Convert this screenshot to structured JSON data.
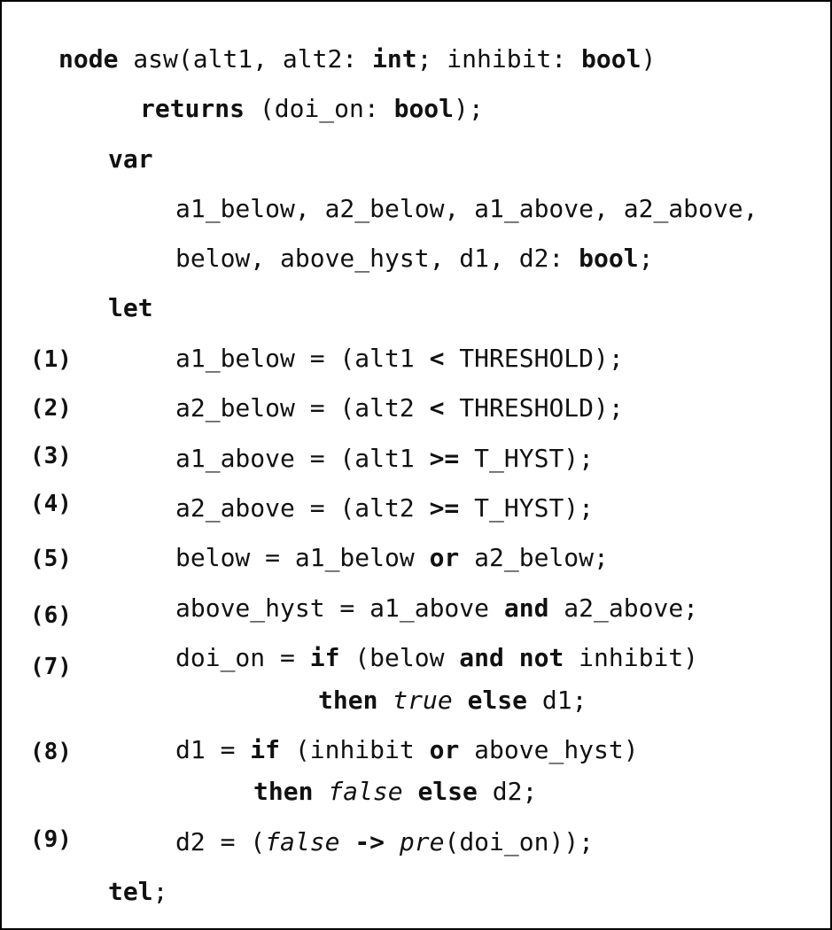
{
  "code": {
    "l1": {
      "kw_node": "node",
      "t1": " asw(alt1, alt2: ",
      "kw_int": "int",
      "t2": "; inhibit: ",
      "kw_bool": "bool",
      "t3": ")"
    },
    "l2": {
      "kw_returns": "returns",
      "t1": " (doi_on: ",
      "kw_bool": "bool",
      "t2": ");"
    },
    "l3": {
      "kw_var": "var"
    },
    "l4": {
      "t1": "a1_below, a2_below, a1_above, a2_above,"
    },
    "l5": {
      "t1": "below, above_hyst, d1, d2: ",
      "kw_bool": "bool",
      "t2": ";"
    },
    "l6": {
      "kw_let": "let"
    },
    "e1": {
      "num": "(1)",
      "t1": "a1_below = (alt1 ",
      "op": "<",
      "t2": " THRESHOLD);"
    },
    "e2": {
      "num": "(2)",
      "t1": "a2_below = (alt2 ",
      "op": "<",
      "t2": " THRESHOLD);"
    },
    "e3": {
      "num": "(3)",
      "t1": "a1_above = (alt1 ",
      "op": ">=",
      "t2": " T_HYST);"
    },
    "e4": {
      "num": "(4)",
      "t1": "a2_above = (alt2 ",
      "op": ">=",
      "t2": " T_HYST);"
    },
    "e5": {
      "num": "(5)",
      "t1": "below = a1_below ",
      "kw_or": "or",
      "t2": " a2_below;"
    },
    "e6": {
      "num": "(6)",
      "t1": "above_hyst = a1_above ",
      "kw_and": "and",
      "t2": " a2_above;"
    },
    "e7": {
      "num": "(7)",
      "t1": "doi_on = ",
      "kw_if": "if",
      "t2": " (below ",
      "kw_and": "and",
      "t3": " ",
      "kw_not": "not",
      "t4": " inhibit)",
      "kw_then": "then",
      "t5": " ",
      "lit_true": "true",
      "t6": " ",
      "kw_else": "else",
      "t7": " d1;"
    },
    "e8": {
      "num": "(8)",
      "t1": "d1 = ",
      "kw_if": "if",
      "t2": " (inhibit ",
      "kw_or": "or",
      "t3": " above_hyst)",
      "kw_then": "then",
      "t4": " ",
      "lit_false": "false",
      "t5": " ",
      "kw_else": "else",
      "t6": " d2;"
    },
    "e9": {
      "num": "(9)",
      "t1": "d2 = (",
      "lit_false": "false",
      "t2": " ",
      "op": "->",
      "t3": " ",
      "fn_pre": "pre",
      "t4": "(doi_on));"
    },
    "end": {
      "kw_tel": "tel",
      "t1": ";"
    }
  }
}
